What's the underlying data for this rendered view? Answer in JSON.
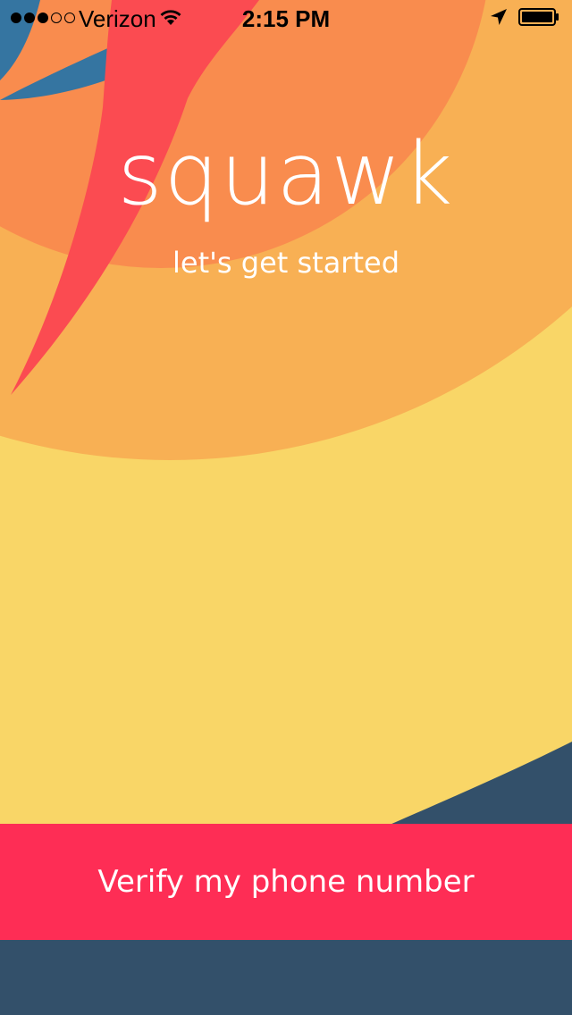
{
  "status_bar": {
    "signal_filled": 3,
    "signal_total": 5,
    "carrier": "Verizon",
    "time": "2:15 PM",
    "icons": [
      "wifi-icon",
      "location-arrow-icon",
      "battery-icon"
    ]
  },
  "app": {
    "logo": "squawk",
    "subtitle": "let's get started"
  },
  "actions": {
    "verify_label": "Verify my phone number"
  },
  "colors": {
    "orange_dark": "#f98c4e",
    "orange_light": "#f8b054",
    "yellow": "#f9d667",
    "red": "#fb4b51",
    "blue": "#3575a1",
    "navy": "#33506a",
    "button": "#fe2d55"
  }
}
